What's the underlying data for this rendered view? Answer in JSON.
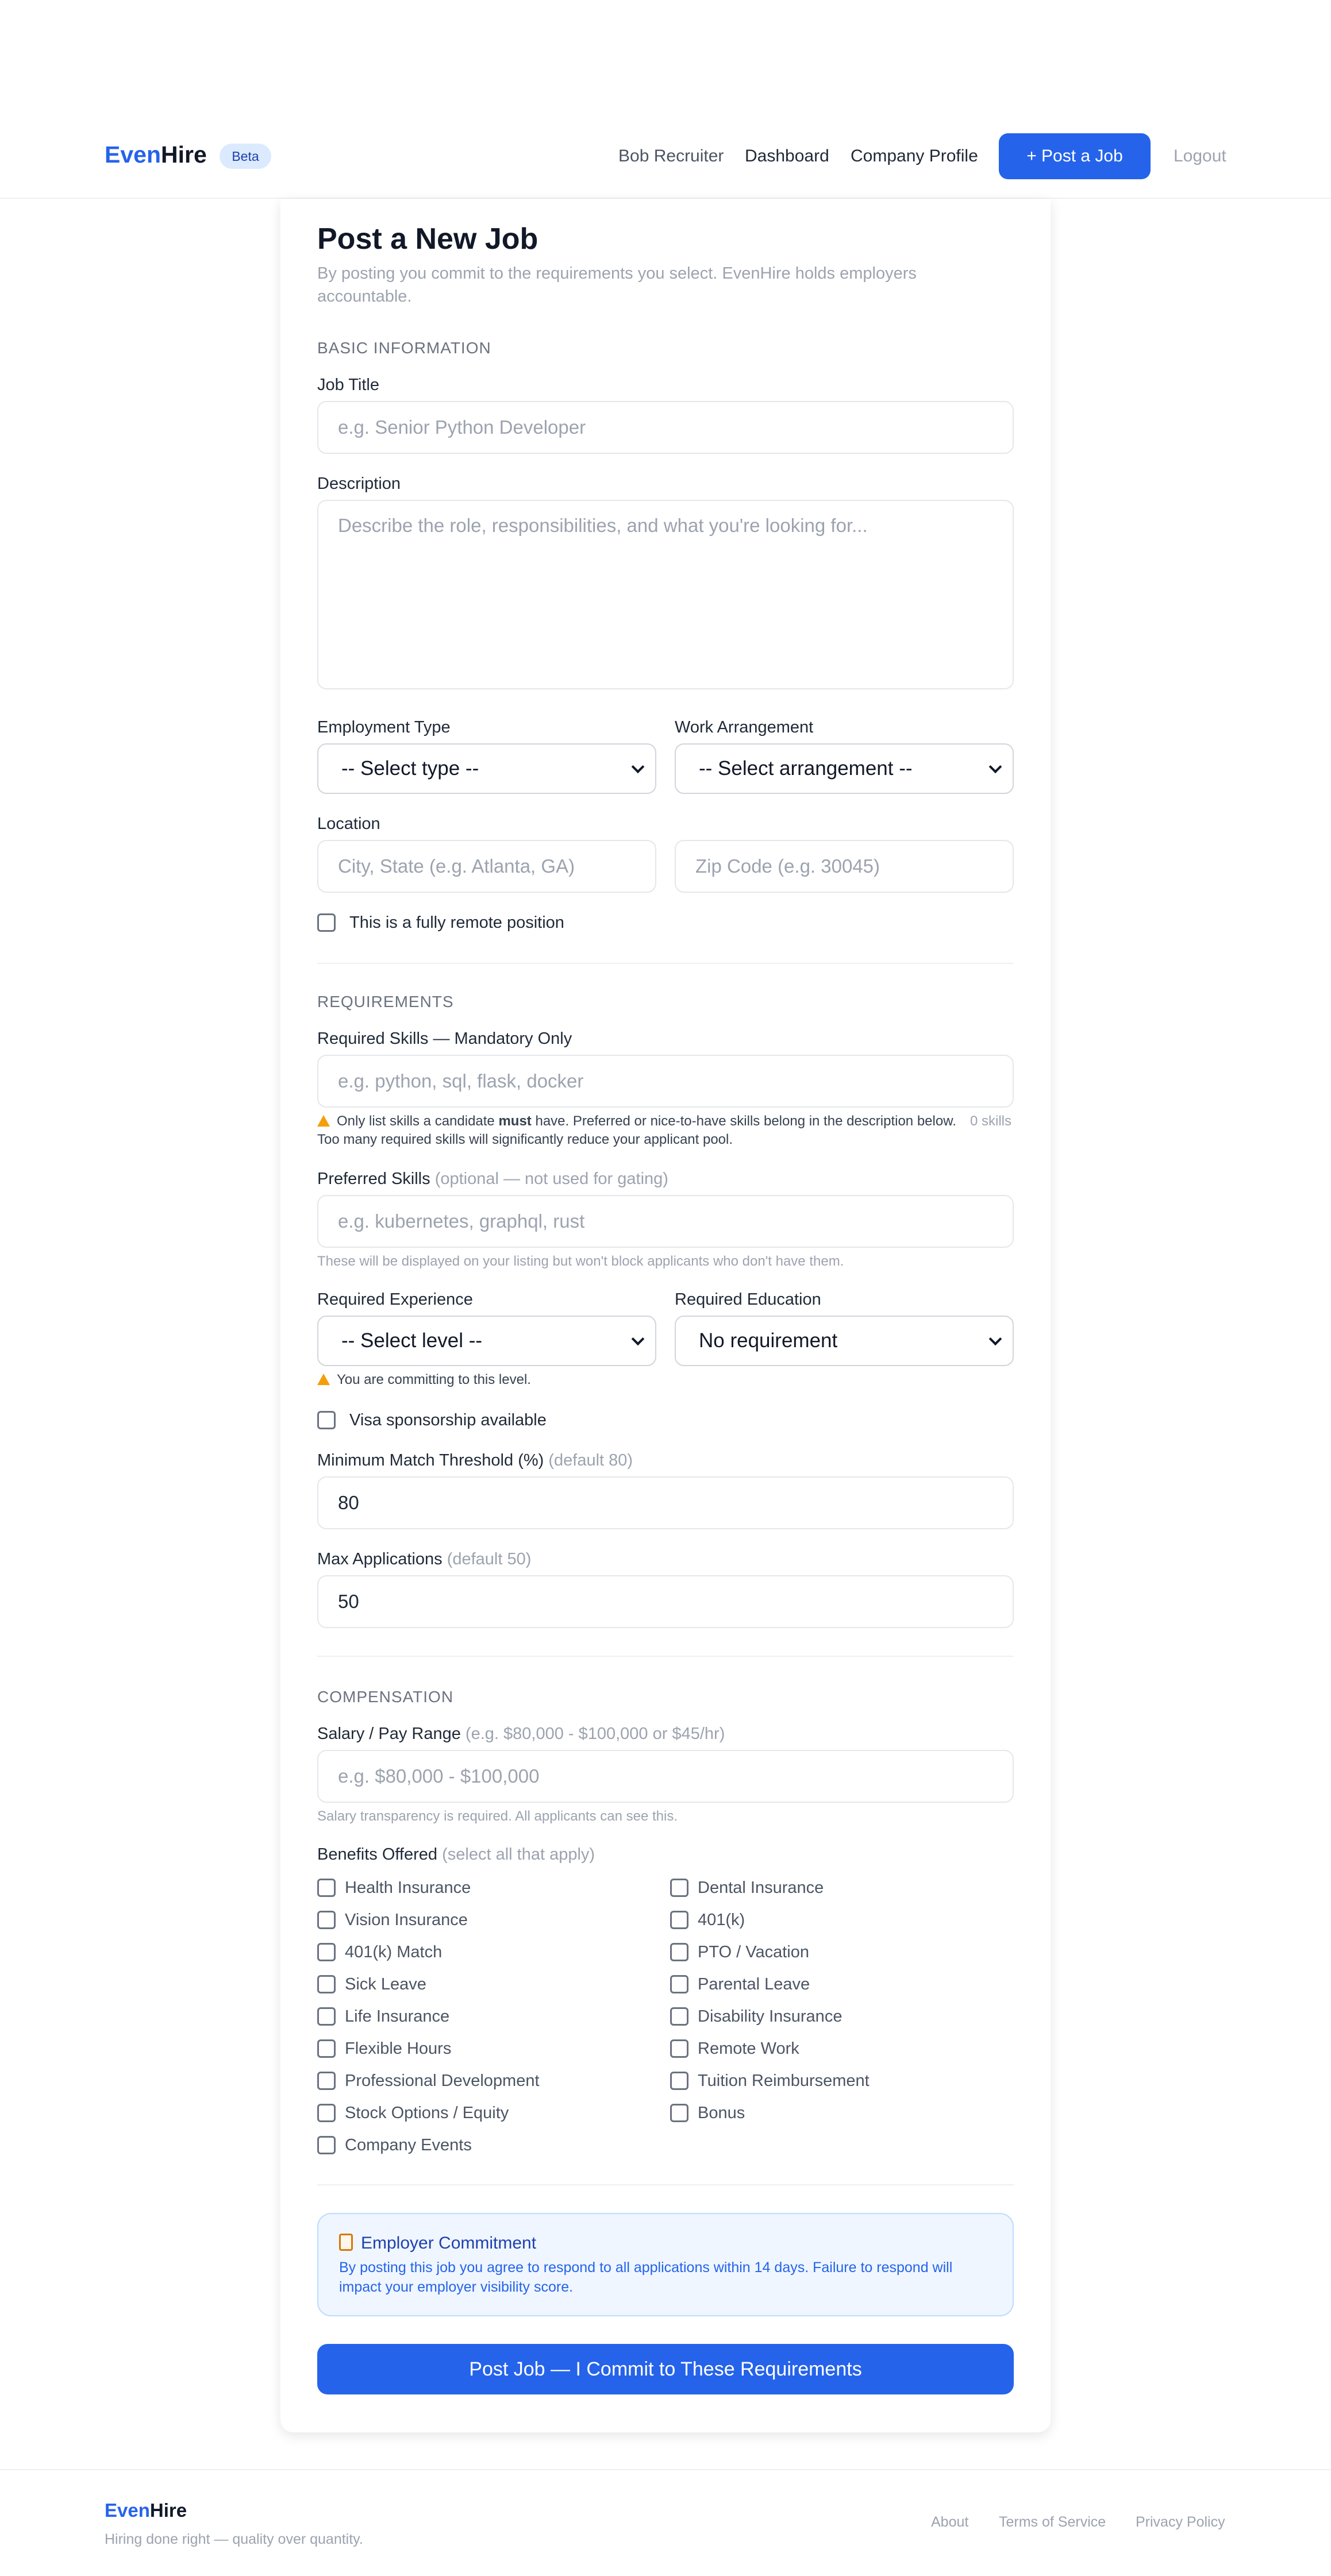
{
  "header": {
    "brand_part1": "Even",
    "brand_part2": "Hire",
    "beta": "Beta",
    "nav": {
      "user": "Bob Recruiter",
      "dashboard": "Dashboard",
      "company_profile": "Company Profile",
      "post_job": "+ Post a Job",
      "logout": "Logout"
    }
  },
  "form": {
    "title": "Post a New Job",
    "subtitle": "By posting you commit to the requirements you select. EvenHire holds employers accountable.",
    "basic": {
      "section": "BASIC INFORMATION",
      "job_title_label": "Job Title",
      "job_title_placeholder": "e.g. Senior Python Developer",
      "description_label": "Description",
      "description_placeholder": "Describe the role, responsibilities, and what you're looking for...",
      "employment_type_label": "Employment Type",
      "employment_type_value": "-- Select type --",
      "work_arrangement_label": "Work Arrangement",
      "work_arrangement_value": "-- Select arrangement --",
      "location_label": "Location",
      "city_placeholder": "City, State (e.g. Atlanta, GA)",
      "zip_placeholder": "Zip Code (e.g. 30045)",
      "remote_label": "This is a fully remote position"
    },
    "requirements": {
      "section": "REQUIREMENTS",
      "required_skills_label": "Required Skills — Mandatory Only",
      "required_skills_placeholder": "e.g. python, sql, flask, docker",
      "skills_warning_pre": "Only list skills a candidate ",
      "skills_warning_bold": "must",
      "skills_warning_post": " have. Preferred or nice-to-have skills belong in the description below. Too many required skills will significantly reduce your applicant pool.",
      "skills_count": "0 skills",
      "preferred_skills_label": "Preferred Skills",
      "preferred_skills_hint": "(optional — not used for gating)",
      "preferred_skills_placeholder": "e.g. kubernetes, graphql, rust",
      "preferred_helper": "These will be displayed on your listing but won't block applicants who don't have them.",
      "experience_label": "Required Experience",
      "experience_value": "-- Select level --",
      "education_label": "Required Education",
      "education_value": "No requirement",
      "commit_warning": "You are committing to this level.",
      "visa_label": "Visa sponsorship available",
      "threshold_label": "Minimum Match Threshold (%)",
      "threshold_hint": "(default 80)",
      "threshold_value": "80",
      "max_apps_label": "Max Applications",
      "max_apps_hint": "(default 50)",
      "max_apps_value": "50"
    },
    "compensation": {
      "section": "COMPENSATION",
      "salary_label": "Salary / Pay Range",
      "salary_hint": "(e.g. $80,000 - $100,000 or $45/hr)",
      "salary_placeholder": "e.g. $80,000 - $100,000",
      "salary_helper": "Salary transparency is required. All applicants can see this.",
      "benefits_label": "Benefits Offered",
      "benefits_hint": "(select all that apply)",
      "benefits": [
        "Health Insurance",
        "Dental Insurance",
        "Vision Insurance",
        "401(k)",
        "401(k) Match",
        "PTO / Vacation",
        "Sick Leave",
        "Parental Leave",
        "Life Insurance",
        "Disability Insurance",
        "Flexible Hours",
        "Remote Work",
        "Professional Development",
        "Tuition Reimbursement",
        "Stock Options / Equity",
        "Bonus",
        "Company Events"
      ]
    },
    "commitment": {
      "title": "Employer Commitment",
      "text": "By posting this job you agree to respond to all applications within 14 days. Failure to respond will impact your employer visibility score."
    },
    "submit_label": "Post Job — I Commit to These Requirements"
  },
  "footer": {
    "brand_part1": "Even",
    "brand_part2": "Hire",
    "tagline": "Hiring done right — quality over quantity.",
    "links": [
      "About",
      "Terms of Service",
      "Privacy Policy"
    ]
  },
  "colors": {
    "accent": "#2563eb",
    "warning": "#f59e0b",
    "commit_bg": "#eff6ff"
  }
}
